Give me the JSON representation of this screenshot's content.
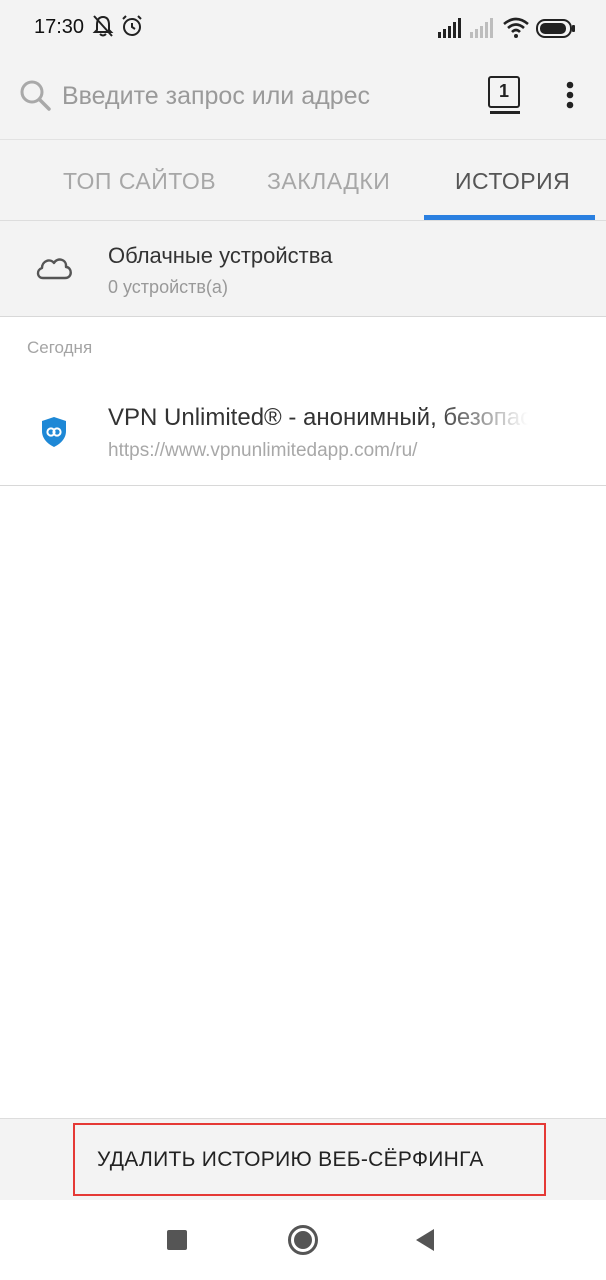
{
  "status_bar": {
    "time": "17:30",
    "icons": [
      "notifications-off-icon",
      "alarm-icon",
      "signal-icon",
      "signal-empty-icon",
      "wifi-icon",
      "battery-icon"
    ]
  },
  "url_bar": {
    "placeholder": "Введите запрос или адрес",
    "tabs_count": "1"
  },
  "panel_tabs": [
    {
      "label": "ТОП САЙТОВ",
      "active": false
    },
    {
      "label": "ЗАКЛАДКИ",
      "active": false
    },
    {
      "label": "ИСТОРИЯ",
      "active": true
    }
  ],
  "cloud_devices": {
    "title": "Облачные устройства",
    "subtitle": "0 устройств(а)"
  },
  "history": {
    "section_label": "Сегодня",
    "items": [
      {
        "title": "VPN Unlimited® - анонимный, безопасный VPN",
        "url": "https://www.vpnunlimitedapp.com/ru/"
      }
    ]
  },
  "clear_history": {
    "label": "УДАЛИТЬ ИСТОРИЮ ВЕБ-СЁРФИНГА"
  },
  "colors": {
    "accent": "#2a7fe0",
    "highlight_border": "#e53935",
    "panel_background": "#f3f3f3"
  }
}
